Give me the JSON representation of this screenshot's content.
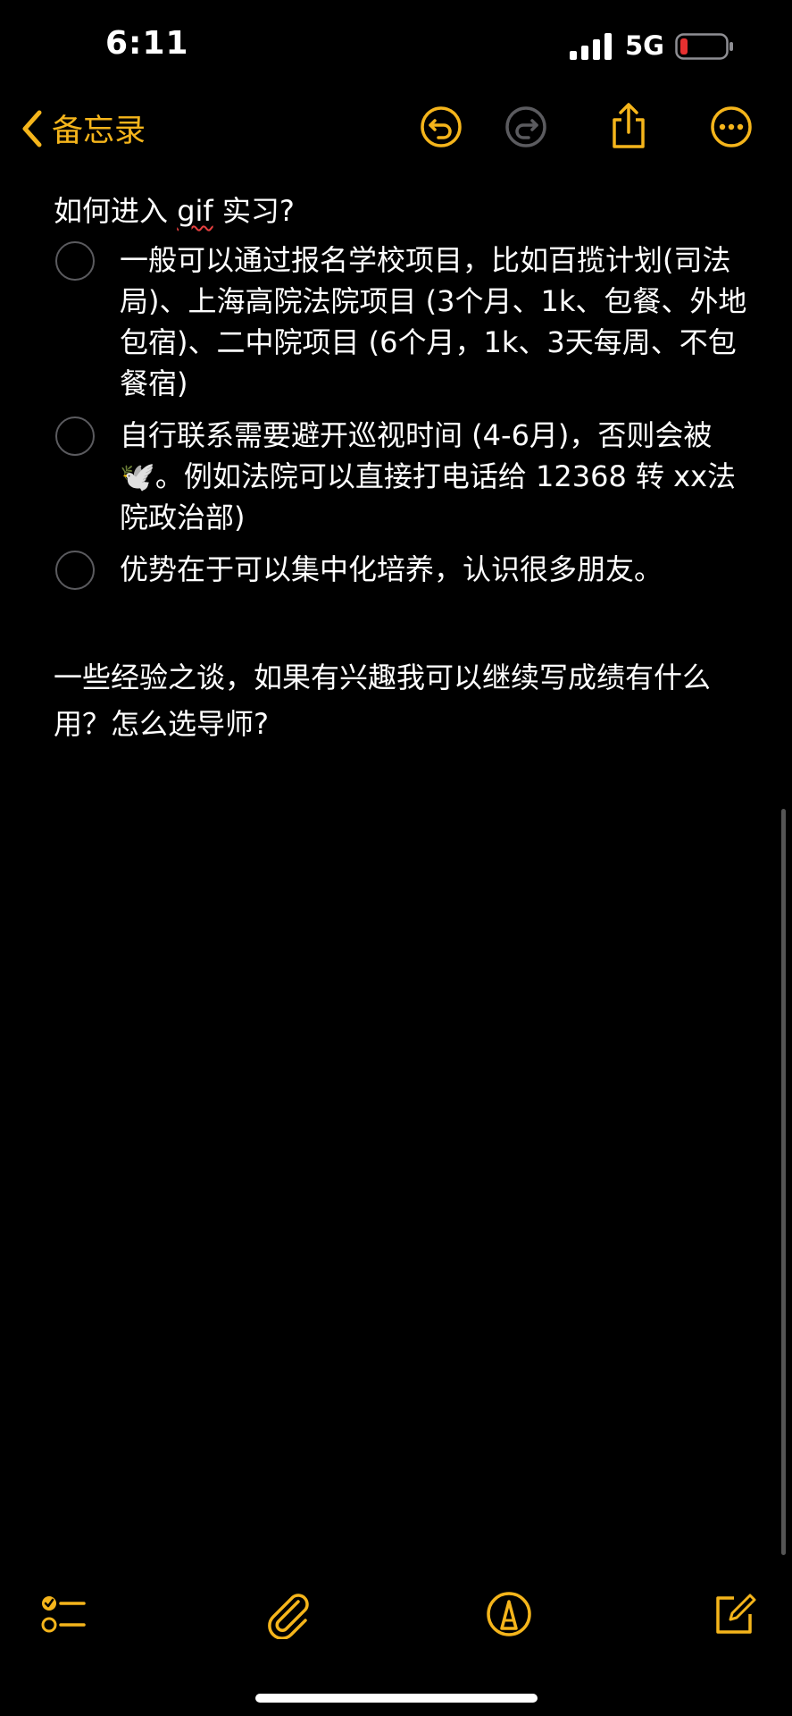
{
  "status_bar": {
    "time": "6:11",
    "network": "5G"
  },
  "nav": {
    "back_label": "备忘录",
    "icons": [
      "chevron-left-icon",
      "undo-icon",
      "redo-icon",
      "share-icon",
      "more-icon"
    ]
  },
  "note": {
    "title_before": "如何进入 ",
    "title_misspelled": "gif",
    "title_after": " 实习?",
    "checklist": [
      {
        "text": "一般可以通过报名学校项目，比如百揽计划(司法局)、上海高院法院项目 (3个月、1k、包餐、外地包宿)、二中院项目 (6个月，1k、3天每周、不包餐宿)",
        "checked": false
      },
      {
        "text": "自行联系需要避开巡视时间 (4-6月)，否则会被🕊️。例如法院可以直接打电话给 12368 转 xx法院政治部)",
        "checked": false
      },
      {
        "text": "优势在于可以集中化培养，认识很多朋友。",
        "checked": false
      }
    ],
    "closing": "一些经验之谈，如果有兴趣我可以继续写成绩有什么用？怎么选导师?"
  },
  "toolbar": {
    "icons": [
      "checklist-icon",
      "attachment-icon",
      "markup-icon",
      "compose-icon"
    ]
  },
  "colors": {
    "accent": "#f5b51b",
    "background": "#000000",
    "disabled": "#5b5b5f",
    "battery_low": "#e63030"
  }
}
